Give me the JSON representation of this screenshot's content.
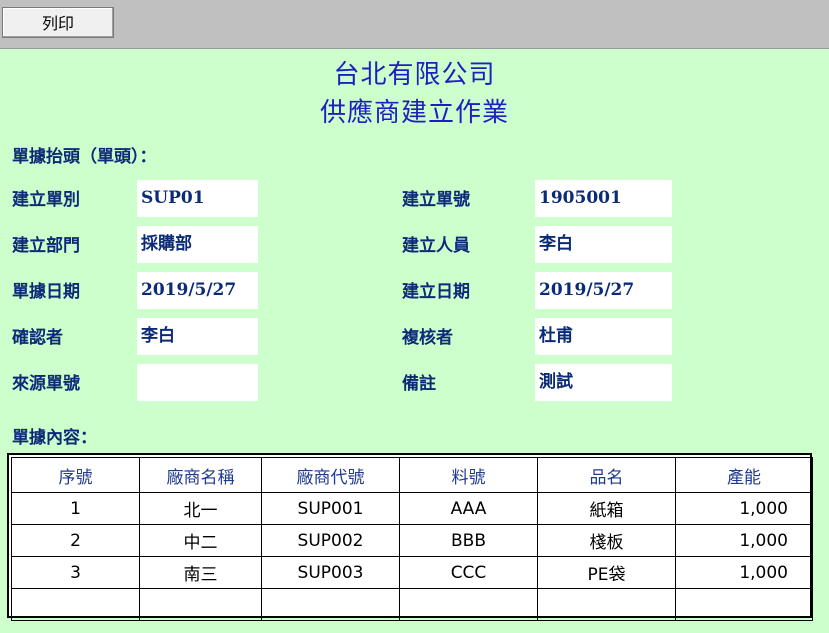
{
  "toolbar": {
    "print_label": "列印"
  },
  "header": {
    "company": "台北有限公司",
    "form_title": "供應商建立作業"
  },
  "sections": {
    "head": "單據抬頭（單頭）：",
    "body": "單據內容："
  },
  "fields": {
    "doc_type": {
      "label": "建立單別",
      "value": "SUP01"
    },
    "doc_no": {
      "label": "建立單號",
      "value": "1905001"
    },
    "department": {
      "label": "建立部門",
      "value": "採購部"
    },
    "creator": {
      "label": "建立人員",
      "value": "李白"
    },
    "doc_date": {
      "label": "單據日期",
      "value": "2019/5/27"
    },
    "create_date": {
      "label": "建立日期",
      "value": "2019/5/27"
    },
    "confirmer": {
      "label": "確認者",
      "value": "李白"
    },
    "reviewer": {
      "label": "複核者",
      "value": "杜甫"
    },
    "source_no": {
      "label": "來源單號",
      "value": ""
    },
    "remark": {
      "label": "備註",
      "value": "測試"
    }
  },
  "table": {
    "columns": [
      "序號",
      "廠商名稱",
      "廠商代號",
      "料號",
      "品名",
      "產能"
    ],
    "rows": [
      [
        "1",
        "北一",
        "SUP001",
        "AAA",
        "紙箱",
        "1,000"
      ],
      [
        "2",
        "中二",
        "SUP002",
        "BBB",
        "棧板",
        "1,000"
      ],
      [
        "3",
        "南三",
        "SUP003",
        "CCC",
        "PE袋",
        "1,000"
      ],
      [
        "",
        "",
        "",
        "",
        "",
        ""
      ]
    ]
  }
}
